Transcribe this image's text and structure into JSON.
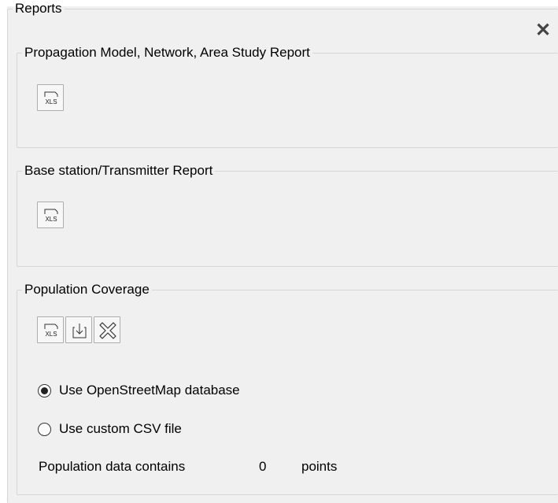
{
  "reports": {
    "title": "Reports",
    "close_glyph": "✕",
    "propagation": {
      "title": "Propagation Model, Network, Area Study Report",
      "export_label": "XLS"
    },
    "base_station": {
      "title": "Base station/Transmitter Report",
      "export_label": "XLS"
    },
    "population": {
      "title": "Population Coverage",
      "export_label": "XLS",
      "radio_osm": "Use OpenStreetMap database",
      "radio_csv": "Use custom CSV file",
      "selected_option": "osm",
      "data_label": "Population data contains",
      "count": "0",
      "unit": "points"
    }
  },
  "icons": [
    "xls-export-icon",
    "download-icon",
    "clear-icon",
    "close-icon"
  ]
}
